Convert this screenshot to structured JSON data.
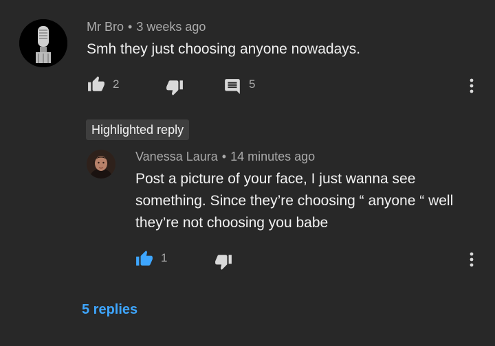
{
  "comment": {
    "author": "Mr Bro",
    "separator": "•",
    "time": "3 weeks ago",
    "text": "Smh they just choosing anyone nowadays.",
    "like_count": "2",
    "reply_count": "5"
  },
  "highlight_label": "Highlighted reply",
  "reply": {
    "author": "Vanessa Laura",
    "separator": "•",
    "time": "14 minutes ago",
    "text_lines": [
      "Post a picture of your face, I just wanna see",
      "something. Since they’re choosing “ anyone “ well",
      "they’re not choosing you babe"
    ],
    "like_count": "1"
  },
  "replies_link": "5 replies",
  "colors": {
    "background": "#282828",
    "accent": "#3ea6ff",
    "muted": "#aaaaaa",
    "like_active": "#3ea6ff"
  },
  "icons": {
    "like": "thumbs-up-icon",
    "dislike": "thumbs-down-icon",
    "reply": "comment-icon",
    "menu": "more-vert-icon"
  }
}
